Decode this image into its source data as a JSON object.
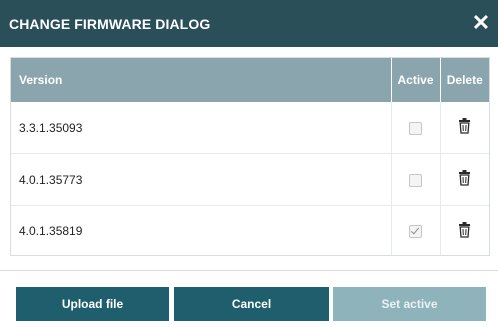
{
  "dialog": {
    "title": "CHANGE FIRMWARE DIALOG",
    "close_symbol": "✕",
    "close_icon": "close-icon"
  },
  "table": {
    "headers": {
      "version": "Version",
      "active": "Active",
      "delete": "Delete"
    },
    "rows": [
      {
        "version": "3.3.1.35093",
        "active": false,
        "delete_icon": "trash-icon"
      },
      {
        "version": "4.0.1.35773",
        "active": false,
        "delete_icon": "trash-icon"
      },
      {
        "version": "4.0.1.35819",
        "active": true,
        "delete_icon": "trash-icon"
      }
    ]
  },
  "buttons": {
    "upload": "Upload file",
    "cancel": "Cancel",
    "set_active": "Set active"
  },
  "colors": {
    "titlebar": "#2b4f59",
    "header": "#8aa5ad",
    "button_primary": "#1f5e6c",
    "button_disabled": "#8fb3ba"
  }
}
